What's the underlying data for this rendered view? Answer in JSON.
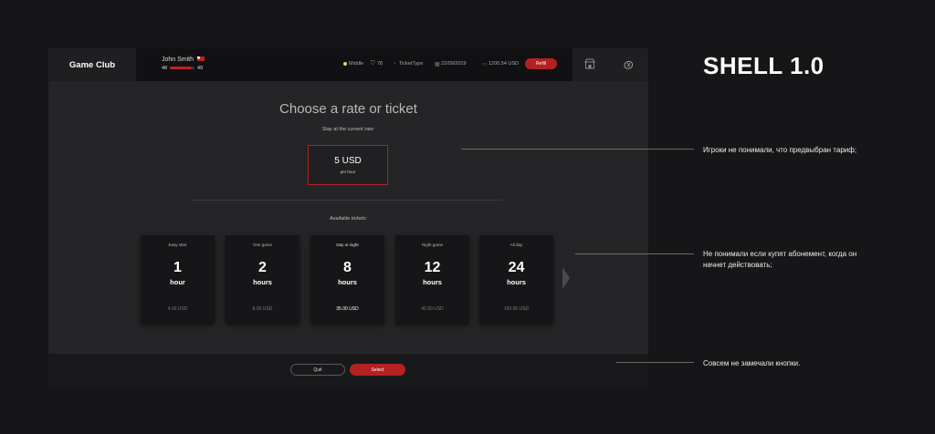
{
  "app": {
    "brand": "Game Club"
  },
  "user": {
    "name": "John Smith",
    "badge": "ЗД",
    "hp_left": "48",
    "hp_right": "49",
    "hp_progress": 0.85
  },
  "topbar": {
    "level": "Middle",
    "points": "78",
    "ticket_type": "TicketType",
    "date": "22/09/2019",
    "balance": "1200.54 USD",
    "refill_label": "Refill",
    "icons": {
      "level": "level-dot-icon",
      "points": "points-icon",
      "ticket": "ticket-icon",
      "date": "calendar-icon",
      "balance": "wallet-icon",
      "shop": "shop-icon",
      "language": "language-icon"
    }
  },
  "content": {
    "title": "Choose a rate or ticket",
    "stay_label": "Stay at the current rate:",
    "current_rate": {
      "value": "5 USD",
      "unit": "per hour"
    },
    "available_label": "Available tickets:",
    "tickets": [
      {
        "name": "Easy start",
        "number": "1",
        "unit": "hour",
        "price": "4.00 USD",
        "selected": false
      },
      {
        "name": "One game",
        "number": "2",
        "unit": "hours",
        "price": "8.00 USD",
        "selected": false
      },
      {
        "name": "Day or night",
        "number": "8",
        "unit": "hours",
        "price": "35.00 USD",
        "selected": true
      },
      {
        "name": "Night game",
        "number": "12",
        "unit": "hours",
        "price": "42.00 USD",
        "selected": false
      },
      {
        "name": "All day",
        "number": "24",
        "unit": "hours",
        "price": "100.00 USD",
        "selected": false
      }
    ]
  },
  "footer": {
    "quit_label": "Quit",
    "select_label": "Select"
  },
  "annotations": {
    "title": "SHELL 1.0",
    "note1": "Игроки не понимали, что предвыбран тариф;",
    "note2": "Не понимали если купят абонемент, когда он начнет действовать;",
    "note3": "Совсем не замечали кнопки."
  },
  "colors": {
    "accent": "#b42121",
    "background": "#161618",
    "panel": "#252527",
    "card": "#161618",
    "level_dot": "#e8d55a"
  }
}
